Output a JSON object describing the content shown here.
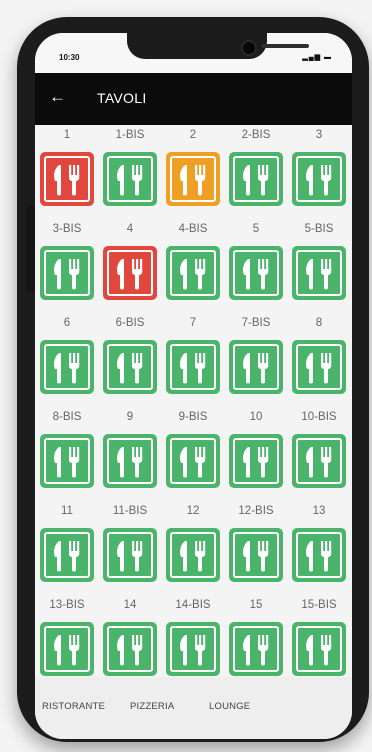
{
  "status_bar": {
    "time": "10:30",
    "icons": "▂▄▆ ▬"
  },
  "header": {
    "title": "TAVOLI",
    "back_icon": "←"
  },
  "colors": {
    "free": "#4ab56a",
    "occupied": "#e2473e",
    "reserved": "#eea024"
  },
  "tables": [
    {
      "label": "1",
      "status": "occupied"
    },
    {
      "label": "1-BIS",
      "status": "free"
    },
    {
      "label": "2",
      "status": "reserved"
    },
    {
      "label": "2-BIS",
      "status": "free"
    },
    {
      "label": "3",
      "status": "free"
    },
    {
      "label": "3-BIS",
      "status": "free"
    },
    {
      "label": "4",
      "status": "occupied"
    },
    {
      "label": "4-BIS",
      "status": "free"
    },
    {
      "label": "5",
      "status": "free"
    },
    {
      "label": "5-BIS",
      "status": "free"
    },
    {
      "label": "6",
      "status": "free"
    },
    {
      "label": "6-BIS",
      "status": "free"
    },
    {
      "label": "7",
      "status": "free"
    },
    {
      "label": "7-BIS",
      "status": "free"
    },
    {
      "label": "8",
      "status": "free"
    },
    {
      "label": "8-BIS",
      "status": "free"
    },
    {
      "label": "9",
      "status": "free"
    },
    {
      "label": "9-BIS",
      "status": "free"
    },
    {
      "label": "10",
      "status": "free"
    },
    {
      "label": "10-BIS",
      "status": "free"
    },
    {
      "label": "11",
      "status": "free"
    },
    {
      "label": "11-BIS",
      "status": "free"
    },
    {
      "label": "12",
      "status": "free"
    },
    {
      "label": "12-BIS",
      "status": "free"
    },
    {
      "label": "13",
      "status": "free"
    },
    {
      "label": "13-BIS",
      "status": "free"
    },
    {
      "label": "14",
      "status": "free"
    },
    {
      "label": "14-BIS",
      "status": "free"
    },
    {
      "label": "15",
      "status": "free"
    },
    {
      "label": "15-BIS",
      "status": "free"
    }
  ],
  "tabs": [
    {
      "label": "RISTORANTE"
    },
    {
      "label": "PIZZERIA"
    },
    {
      "label": "LOUNGE"
    }
  ]
}
